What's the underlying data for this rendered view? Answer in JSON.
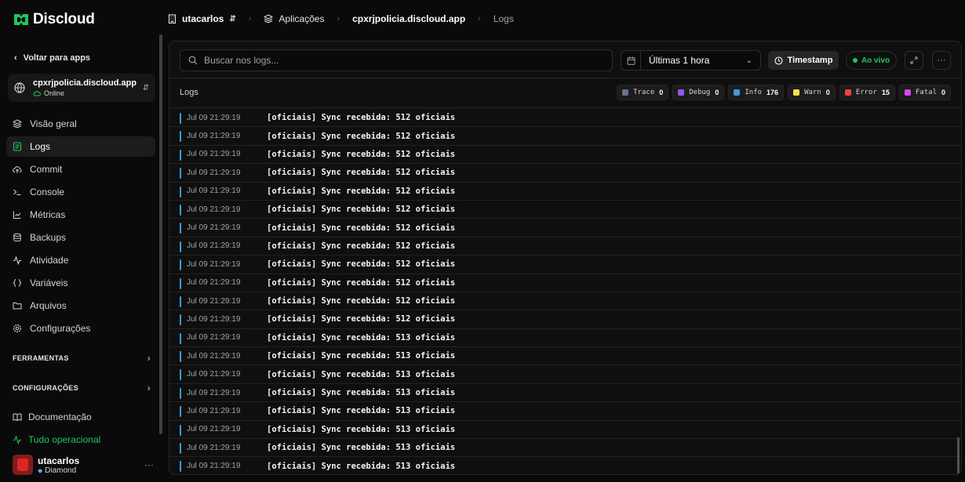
{
  "brand": {
    "name": "Discloud",
    "color": "#22c55e"
  },
  "sidebar": {
    "back_label": "Voltar para apps",
    "app": {
      "name": "cpxrjpolicia.discloud.app",
      "status": "Online"
    },
    "items": [
      {
        "label": "Visão geral",
        "icon": "layers-icon"
      },
      {
        "label": "Logs",
        "icon": "logs-icon",
        "active": true
      },
      {
        "label": "Commit",
        "icon": "cloud-upload-icon"
      },
      {
        "label": "Console",
        "icon": "terminal-icon"
      },
      {
        "label": "Métricas",
        "icon": "chart-icon"
      },
      {
        "label": "Backups",
        "icon": "database-icon"
      },
      {
        "label": "Atividade",
        "icon": "activity-icon"
      },
      {
        "label": "Variáveis",
        "icon": "braces-icon"
      },
      {
        "label": "Arquivos",
        "icon": "folder-icon"
      },
      {
        "label": "Configurações",
        "icon": "gear-icon"
      }
    ],
    "section_tools": "FERRAMENTAS",
    "section_settings": "CONFIGURAÇÕES",
    "docs_label": "Documentação",
    "status_label": "Tudo operacional",
    "user": {
      "name": "utacarlos",
      "plan": "Diamond"
    }
  },
  "topbar": {
    "workspace": "utacarlos",
    "apps": "Aplicações",
    "app": "cpxrjpolicia.discloud.app",
    "page": "Logs"
  },
  "toolbar": {
    "search_placeholder": "Buscar nos logs...",
    "range": "Últimas 1 hora",
    "timestamp_label": "Timestamp",
    "live_label": "Ao vivo"
  },
  "logs": {
    "title": "Logs",
    "levels": [
      {
        "name": "Trace",
        "count": "0",
        "color": "#64748b"
      },
      {
        "name": "Debug",
        "count": "0",
        "color": "#8b5cf6"
      },
      {
        "name": "Info",
        "count": "176",
        "color": "#3b9be0"
      },
      {
        "name": "Warn",
        "count": "0",
        "color": "#fde047"
      },
      {
        "name": "Error",
        "count": "15",
        "color": "#ef4444"
      },
      {
        "name": "Fatal",
        "count": "0",
        "color": "#d946ef"
      }
    ],
    "rows": [
      {
        "time": "Jul 09 21:29:19",
        "msg": "[oficiais] Sync recebida: 512 oficiais"
      },
      {
        "time": "Jul 09 21:29:19",
        "msg": "[oficiais] Sync recebida: 512 oficiais"
      },
      {
        "time": "Jul 09 21:29:19",
        "msg": "[oficiais] Sync recebida: 512 oficiais"
      },
      {
        "time": "Jul 09 21:29:19",
        "msg": "[oficiais] Sync recebida: 512 oficiais"
      },
      {
        "time": "Jul 09 21:29:19",
        "msg": "[oficiais] Sync recebida: 512 oficiais"
      },
      {
        "time": "Jul 09 21:29:19",
        "msg": "[oficiais] Sync recebida: 512 oficiais"
      },
      {
        "time": "Jul 09 21:29:19",
        "msg": "[oficiais] Sync recebida: 512 oficiais"
      },
      {
        "time": "Jul 09 21:29:19",
        "msg": "[oficiais] Sync recebida: 512 oficiais"
      },
      {
        "time": "Jul 09 21:29:19",
        "msg": "[oficiais] Sync recebida: 512 oficiais"
      },
      {
        "time": "Jul 09 21:29:19",
        "msg": "[oficiais] Sync recebida: 512 oficiais"
      },
      {
        "time": "Jul 09 21:29:19",
        "msg": "[oficiais] Sync recebida: 512 oficiais"
      },
      {
        "time": "Jul 09 21:29:19",
        "msg": "[oficiais] Sync recebida: 512 oficiais"
      },
      {
        "time": "Jul 09 21:29:19",
        "msg": "[oficiais] Sync recebida: 513 oficiais"
      },
      {
        "time": "Jul 09 21:29:19",
        "msg": "[oficiais] Sync recebida: 513 oficiais"
      },
      {
        "time": "Jul 09 21:29:19",
        "msg": "[oficiais] Sync recebida: 513 oficiais"
      },
      {
        "time": "Jul 09 21:29:19",
        "msg": "[oficiais] Sync recebida: 513 oficiais"
      },
      {
        "time": "Jul 09 21:29:19",
        "msg": "[oficiais] Sync recebida: 513 oficiais"
      },
      {
        "time": "Jul 09 21:29:19",
        "msg": "[oficiais] Sync recebida: 513 oficiais"
      },
      {
        "time": "Jul 09 21:29:19",
        "msg": "[oficiais] Sync recebida: 513 oficiais"
      },
      {
        "time": "Jul 09 21:29:19",
        "msg": "[oficiais] Sync recebida: 513 oficiais"
      }
    ]
  }
}
